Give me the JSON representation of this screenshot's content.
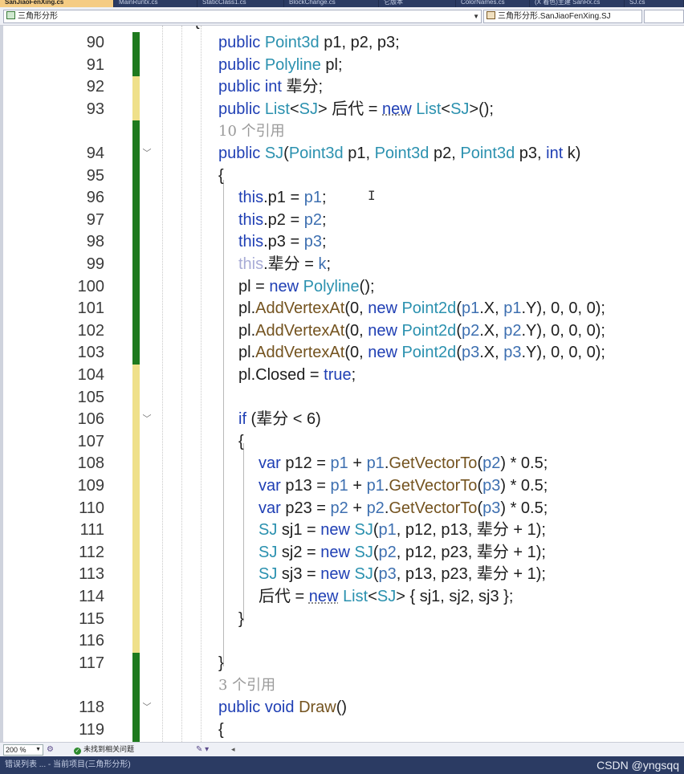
{
  "tabs": [
    {
      "label": "SanJiaoFenXing.cs",
      "active": true
    },
    {
      "label": "MainRuntx.cs",
      "active": false
    },
    {
      "label": "StaticClass1.cs",
      "active": false
    },
    {
      "label": "BlockChange.cs",
      "active": false
    },
    {
      "label": "它版本",
      "active": false
    },
    {
      "label": "ColorNames.cs",
      "active": false
    },
    {
      "label": "(X 着色)主建 SanRx.cs",
      "active": false
    },
    {
      "label": "SJ.cs",
      "active": false
    }
  ],
  "navbar": {
    "project": "三角形分形",
    "member": "三角形分形.SanJiaoFenXing.SJ"
  },
  "code_lines": [
    {
      "n": "90",
      "indent": 1,
      "change": "saved",
      "tokens": [
        [
          "kw",
          "public "
        ],
        [
          "ty",
          "Point3d"
        ],
        [
          "tx",
          " p1, p2, p3;"
        ]
      ]
    },
    {
      "n": "91",
      "indent": 1,
      "change": "saved",
      "tokens": [
        [
          "kw",
          "public "
        ],
        [
          "ty",
          "Polyline"
        ],
        [
          "tx",
          " pl;"
        ]
      ]
    },
    {
      "n": "92",
      "indent": 1,
      "change": "unsaved",
      "tokens": [
        [
          "kw",
          "public int "
        ],
        [
          "tx",
          "辈分;"
        ]
      ]
    },
    {
      "n": "93",
      "indent": 1,
      "change": "unsaved",
      "tokens": [
        [
          "kw",
          "public "
        ],
        [
          "ty",
          "List"
        ],
        [
          "tx",
          "<"
        ],
        [
          "ty",
          "SJ"
        ],
        [
          "tx",
          "> 后代 = "
        ],
        [
          "sq",
          "new"
        ],
        [
          "tx",
          " "
        ],
        [
          "ty",
          "List"
        ],
        [
          "tx",
          "<"
        ],
        [
          "ty",
          "SJ"
        ],
        [
          "tx",
          ">();"
        ]
      ]
    },
    {
      "lens": "10 个引用",
      "indent": 1,
      "change": "saved"
    },
    {
      "n": "94",
      "indent": 1,
      "change": "saved",
      "fold": true,
      "tokens": [
        [
          "kw",
          "public "
        ],
        [
          "ty",
          "SJ"
        ],
        [
          "tx",
          "("
        ],
        [
          "ty",
          "Point3d"
        ],
        [
          "tx",
          " p1, "
        ],
        [
          "ty",
          "Point3d"
        ],
        [
          "tx",
          " p2, "
        ],
        [
          "ty",
          "Point3d"
        ],
        [
          "tx",
          " p3, "
        ],
        [
          "kw",
          "int"
        ],
        [
          "tx",
          " k)"
        ]
      ]
    },
    {
      "n": "95",
      "indent": 1,
      "change": "saved",
      "tokens": [
        [
          "tx",
          "{"
        ]
      ]
    },
    {
      "n": "96",
      "indent": 2,
      "change": "saved",
      "tokens": [
        [
          "kw",
          "this"
        ],
        [
          "tx",
          ".p1 = "
        ],
        [
          "pr",
          "p1"
        ],
        [
          "tx",
          ";"
        ]
      ]
    },
    {
      "n": "97",
      "indent": 2,
      "change": "saved",
      "tokens": [
        [
          "kw",
          "this"
        ],
        [
          "tx",
          ".p2 = "
        ],
        [
          "pr",
          "p2"
        ],
        [
          "tx",
          ";"
        ]
      ]
    },
    {
      "n": "98",
      "indent": 2,
      "change": "saved",
      "tokens": [
        [
          "kw",
          "this"
        ],
        [
          "tx",
          ".p3 = "
        ],
        [
          "pr",
          "p3"
        ],
        [
          "tx",
          ";"
        ]
      ]
    },
    {
      "n": "99",
      "indent": 2,
      "change": "saved",
      "tokens": [
        [
          "dim",
          "this"
        ],
        [
          "tx",
          ".辈分 = "
        ],
        [
          "pr",
          "k"
        ],
        [
          "tx",
          ";"
        ]
      ]
    },
    {
      "n": "100",
      "indent": 2,
      "change": "saved",
      "tokens": [
        [
          "tx",
          "pl = "
        ],
        [
          "kw",
          "new "
        ],
        [
          "ty",
          "Polyline"
        ],
        [
          "tx",
          "();"
        ]
      ]
    },
    {
      "n": "101",
      "indent": 2,
      "change": "saved",
      "tokens": [
        [
          "tx",
          "pl."
        ],
        [
          "fn",
          "AddVertexAt"
        ],
        [
          "tx",
          "(0, "
        ],
        [
          "kw",
          "new "
        ],
        [
          "ty",
          "Point2d"
        ],
        [
          "tx",
          "("
        ],
        [
          "pr",
          "p1"
        ],
        [
          "tx",
          ".X, "
        ],
        [
          "pr",
          "p1"
        ],
        [
          "tx",
          ".Y), 0, 0, 0);"
        ]
      ]
    },
    {
      "n": "102",
      "indent": 2,
      "change": "saved",
      "tokens": [
        [
          "tx",
          "pl."
        ],
        [
          "fn",
          "AddVertexAt"
        ],
        [
          "tx",
          "(0, "
        ],
        [
          "kw",
          "new "
        ],
        [
          "ty",
          "Point2d"
        ],
        [
          "tx",
          "("
        ],
        [
          "pr",
          "p2"
        ],
        [
          "tx",
          ".X, "
        ],
        [
          "pr",
          "p2"
        ],
        [
          "tx",
          ".Y), 0, 0, 0);"
        ]
      ]
    },
    {
      "n": "103",
      "indent": 2,
      "change": "saved",
      "tokens": [
        [
          "tx",
          "pl."
        ],
        [
          "fn",
          "AddVertexAt"
        ],
        [
          "tx",
          "(0, "
        ],
        [
          "kw",
          "new "
        ],
        [
          "ty",
          "Point2d"
        ],
        [
          "tx",
          "("
        ],
        [
          "pr",
          "p3"
        ],
        [
          "tx",
          ".X, "
        ],
        [
          "pr",
          "p3"
        ],
        [
          "tx",
          ".Y), 0, 0, 0);"
        ]
      ]
    },
    {
      "n": "104",
      "indent": 2,
      "change": "unsaved",
      "tokens": [
        [
          "tx",
          "pl.Closed = "
        ],
        [
          "kw",
          "true"
        ],
        [
          "tx",
          ";"
        ]
      ]
    },
    {
      "n": "105",
      "indent": 2,
      "change": "unsaved",
      "tokens": []
    },
    {
      "n": "106",
      "indent": 2,
      "change": "unsaved",
      "fold": true,
      "tokens": [
        [
          "kw",
          "if"
        ],
        [
          "tx",
          " (辈分 < 6)"
        ]
      ]
    },
    {
      "n": "107",
      "indent": 2,
      "change": "unsaved",
      "tokens": [
        [
          "tx",
          "{"
        ]
      ]
    },
    {
      "n": "108",
      "indent": 3,
      "change": "unsaved",
      "tokens": [
        [
          "kw",
          "var"
        ],
        [
          "tx",
          " p12 = "
        ],
        [
          "pr",
          "p1"
        ],
        [
          "tx",
          " + "
        ],
        [
          "pr",
          "p1"
        ],
        [
          "tx",
          "."
        ],
        [
          "fn",
          "GetVectorTo"
        ],
        [
          "tx",
          "("
        ],
        [
          "pr",
          "p2"
        ],
        [
          "tx",
          ") * 0.5;"
        ]
      ]
    },
    {
      "n": "109",
      "indent": 3,
      "change": "unsaved",
      "tokens": [
        [
          "kw",
          "var"
        ],
        [
          "tx",
          " p13 = "
        ],
        [
          "pr",
          "p1"
        ],
        [
          "tx",
          " + "
        ],
        [
          "pr",
          "p1"
        ],
        [
          "tx",
          "."
        ],
        [
          "fn",
          "GetVectorTo"
        ],
        [
          "tx",
          "("
        ],
        [
          "pr",
          "p3"
        ],
        [
          "tx",
          ") * 0.5;"
        ]
      ]
    },
    {
      "n": "110",
      "indent": 3,
      "change": "unsaved",
      "tokens": [
        [
          "kw",
          "var"
        ],
        [
          "tx",
          " p23 = "
        ],
        [
          "pr",
          "p2"
        ],
        [
          "tx",
          " + "
        ],
        [
          "pr",
          "p2"
        ],
        [
          "tx",
          "."
        ],
        [
          "fn",
          "GetVectorTo"
        ],
        [
          "tx",
          "("
        ],
        [
          "pr",
          "p3"
        ],
        [
          "tx",
          ") * 0.5;"
        ]
      ]
    },
    {
      "n": "111",
      "indent": 3,
      "change": "unsaved",
      "tokens": [
        [
          "ty",
          "SJ"
        ],
        [
          "tx",
          " sj1 = "
        ],
        [
          "kw",
          "new "
        ],
        [
          "ty",
          "SJ"
        ],
        [
          "tx",
          "("
        ],
        [
          "pr",
          "p1"
        ],
        [
          "tx",
          ", p12, p13, 辈分 + 1);"
        ]
      ]
    },
    {
      "n": "112",
      "indent": 3,
      "change": "unsaved",
      "tokens": [
        [
          "ty",
          "SJ"
        ],
        [
          "tx",
          " sj2 = "
        ],
        [
          "kw",
          "new "
        ],
        [
          "ty",
          "SJ"
        ],
        [
          "tx",
          "("
        ],
        [
          "pr",
          "p2"
        ],
        [
          "tx",
          ", p12, p23, 辈分 + 1);"
        ]
      ]
    },
    {
      "n": "113",
      "indent": 3,
      "change": "unsaved",
      "tokens": [
        [
          "ty",
          "SJ"
        ],
        [
          "tx",
          " sj3 = "
        ],
        [
          "kw",
          "new "
        ],
        [
          "ty",
          "SJ"
        ],
        [
          "tx",
          "("
        ],
        [
          "pr",
          "p3"
        ],
        [
          "tx",
          ", p13, p23, 辈分 + 1);"
        ]
      ]
    },
    {
      "n": "114",
      "indent": 3,
      "change": "unsaved",
      "tokens": [
        [
          "tx",
          "后代 = "
        ],
        [
          "sq",
          "new"
        ],
        [
          "tx",
          " "
        ],
        [
          "ty",
          "List"
        ],
        [
          "tx",
          "<"
        ],
        [
          "ty",
          "SJ"
        ],
        [
          "tx",
          "> { sj1, sj2, sj3 };"
        ]
      ]
    },
    {
      "n": "115",
      "indent": 2,
      "change": "unsaved",
      "tokens": [
        [
          "tx",
          "}"
        ]
      ]
    },
    {
      "n": "116",
      "indent": 2,
      "change": "unsaved",
      "tokens": []
    },
    {
      "n": "117",
      "indent": 1,
      "change": "saved",
      "tokens": [
        [
          "tx",
          "}"
        ]
      ]
    },
    {
      "lens": "3 个引用",
      "indent": 1,
      "change": "saved"
    },
    {
      "n": "118",
      "indent": 1,
      "change": "saved",
      "fold": true,
      "tokens": [
        [
          "kw",
          "public void "
        ],
        [
          "fn",
          "Draw"
        ],
        [
          "tx",
          "()"
        ]
      ]
    },
    {
      "n": "119",
      "indent": 1,
      "change": "saved",
      "tokens": [
        [
          "tx",
          "{"
        ]
      ]
    }
  ],
  "status": {
    "zoom": "200 %",
    "issues": "未找到相关问题"
  },
  "bottom": {
    "text": "错误列表 ... - 当前项目(三角形分形)",
    "watermark": "CSDN @yngsqq"
  },
  "colors": {
    "keyword": "#1f3fb4",
    "type": "#2b91af",
    "method": "#74531f",
    "saved_change": "#1e7a1e",
    "unsaved_change": "#efe08a",
    "tabbar": "#2b3b63"
  }
}
